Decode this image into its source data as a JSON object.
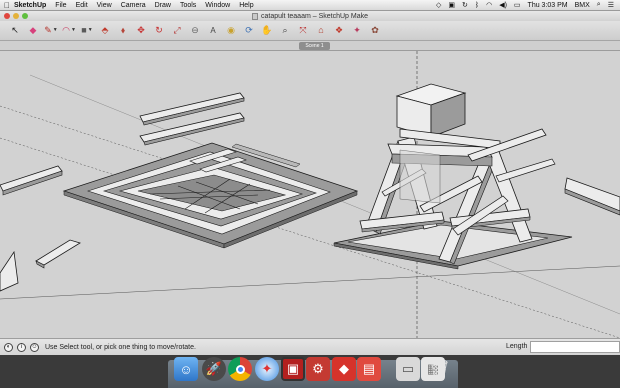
{
  "menubar": {
    "app_name": "SketchUp",
    "menus": [
      "File",
      "Edit",
      "View",
      "Camera",
      "Draw",
      "Tools",
      "Window",
      "Help"
    ],
    "clock": "Thu 3:03 PM",
    "user": "BMX"
  },
  "window": {
    "title": "catapult teaaam – SketchUp Make"
  },
  "toolbar": {
    "tools": [
      {
        "name": "select-tool",
        "glyph": "↖"
      },
      {
        "name": "eraser-tool",
        "glyph": "◆"
      },
      {
        "name": "pencil-tool",
        "glyph": "✎"
      },
      {
        "name": "arc-tool",
        "glyph": "◠"
      },
      {
        "name": "rectangle-tool",
        "glyph": "■"
      },
      {
        "name": "push-pull-tool",
        "glyph": "⬘"
      },
      {
        "name": "offset-tool",
        "glyph": "⬧"
      },
      {
        "name": "move-tool",
        "glyph": "✥"
      },
      {
        "name": "rotate-tool",
        "glyph": "↻"
      },
      {
        "name": "scale-tool",
        "glyph": "⤢"
      },
      {
        "name": "tape-measure-tool",
        "glyph": "⊖"
      },
      {
        "name": "text-tool",
        "glyph": "A"
      },
      {
        "name": "paint-bucket-tool",
        "glyph": "◉"
      },
      {
        "name": "orbit-tool",
        "glyph": "⟳"
      },
      {
        "name": "pan-tool",
        "glyph": "✋"
      },
      {
        "name": "zoom-tool",
        "glyph": "⌕"
      },
      {
        "name": "zoom-extents-tool",
        "glyph": "⤧"
      },
      {
        "name": "warehouse-tool",
        "glyph": "⌂"
      },
      {
        "name": "components-tool",
        "glyph": "❖"
      },
      {
        "name": "extension-tool",
        "glyph": "✦"
      },
      {
        "name": "model-info-tool",
        "glyph": "✿"
      }
    ]
  },
  "scene": {
    "tab_label": "Scene 1"
  },
  "statusbar": {
    "message": "Use Select tool, or pick one thing to move/rotate.",
    "length_label": "Length",
    "length_value": ""
  },
  "dock": {
    "apps": [
      "Finder",
      "Launchpad",
      "Chrome",
      "Safari",
      "Photo Booth",
      "Preferences",
      "SketchUp",
      "SketchUp Layout",
      "Document",
      "Preview",
      "Trash"
    ]
  },
  "colors": {
    "viewport_bg": "#d2d2d2",
    "face_gray": "#9b9b9b",
    "face_light": "#ececec",
    "edge": "#1a1a1a"
  }
}
